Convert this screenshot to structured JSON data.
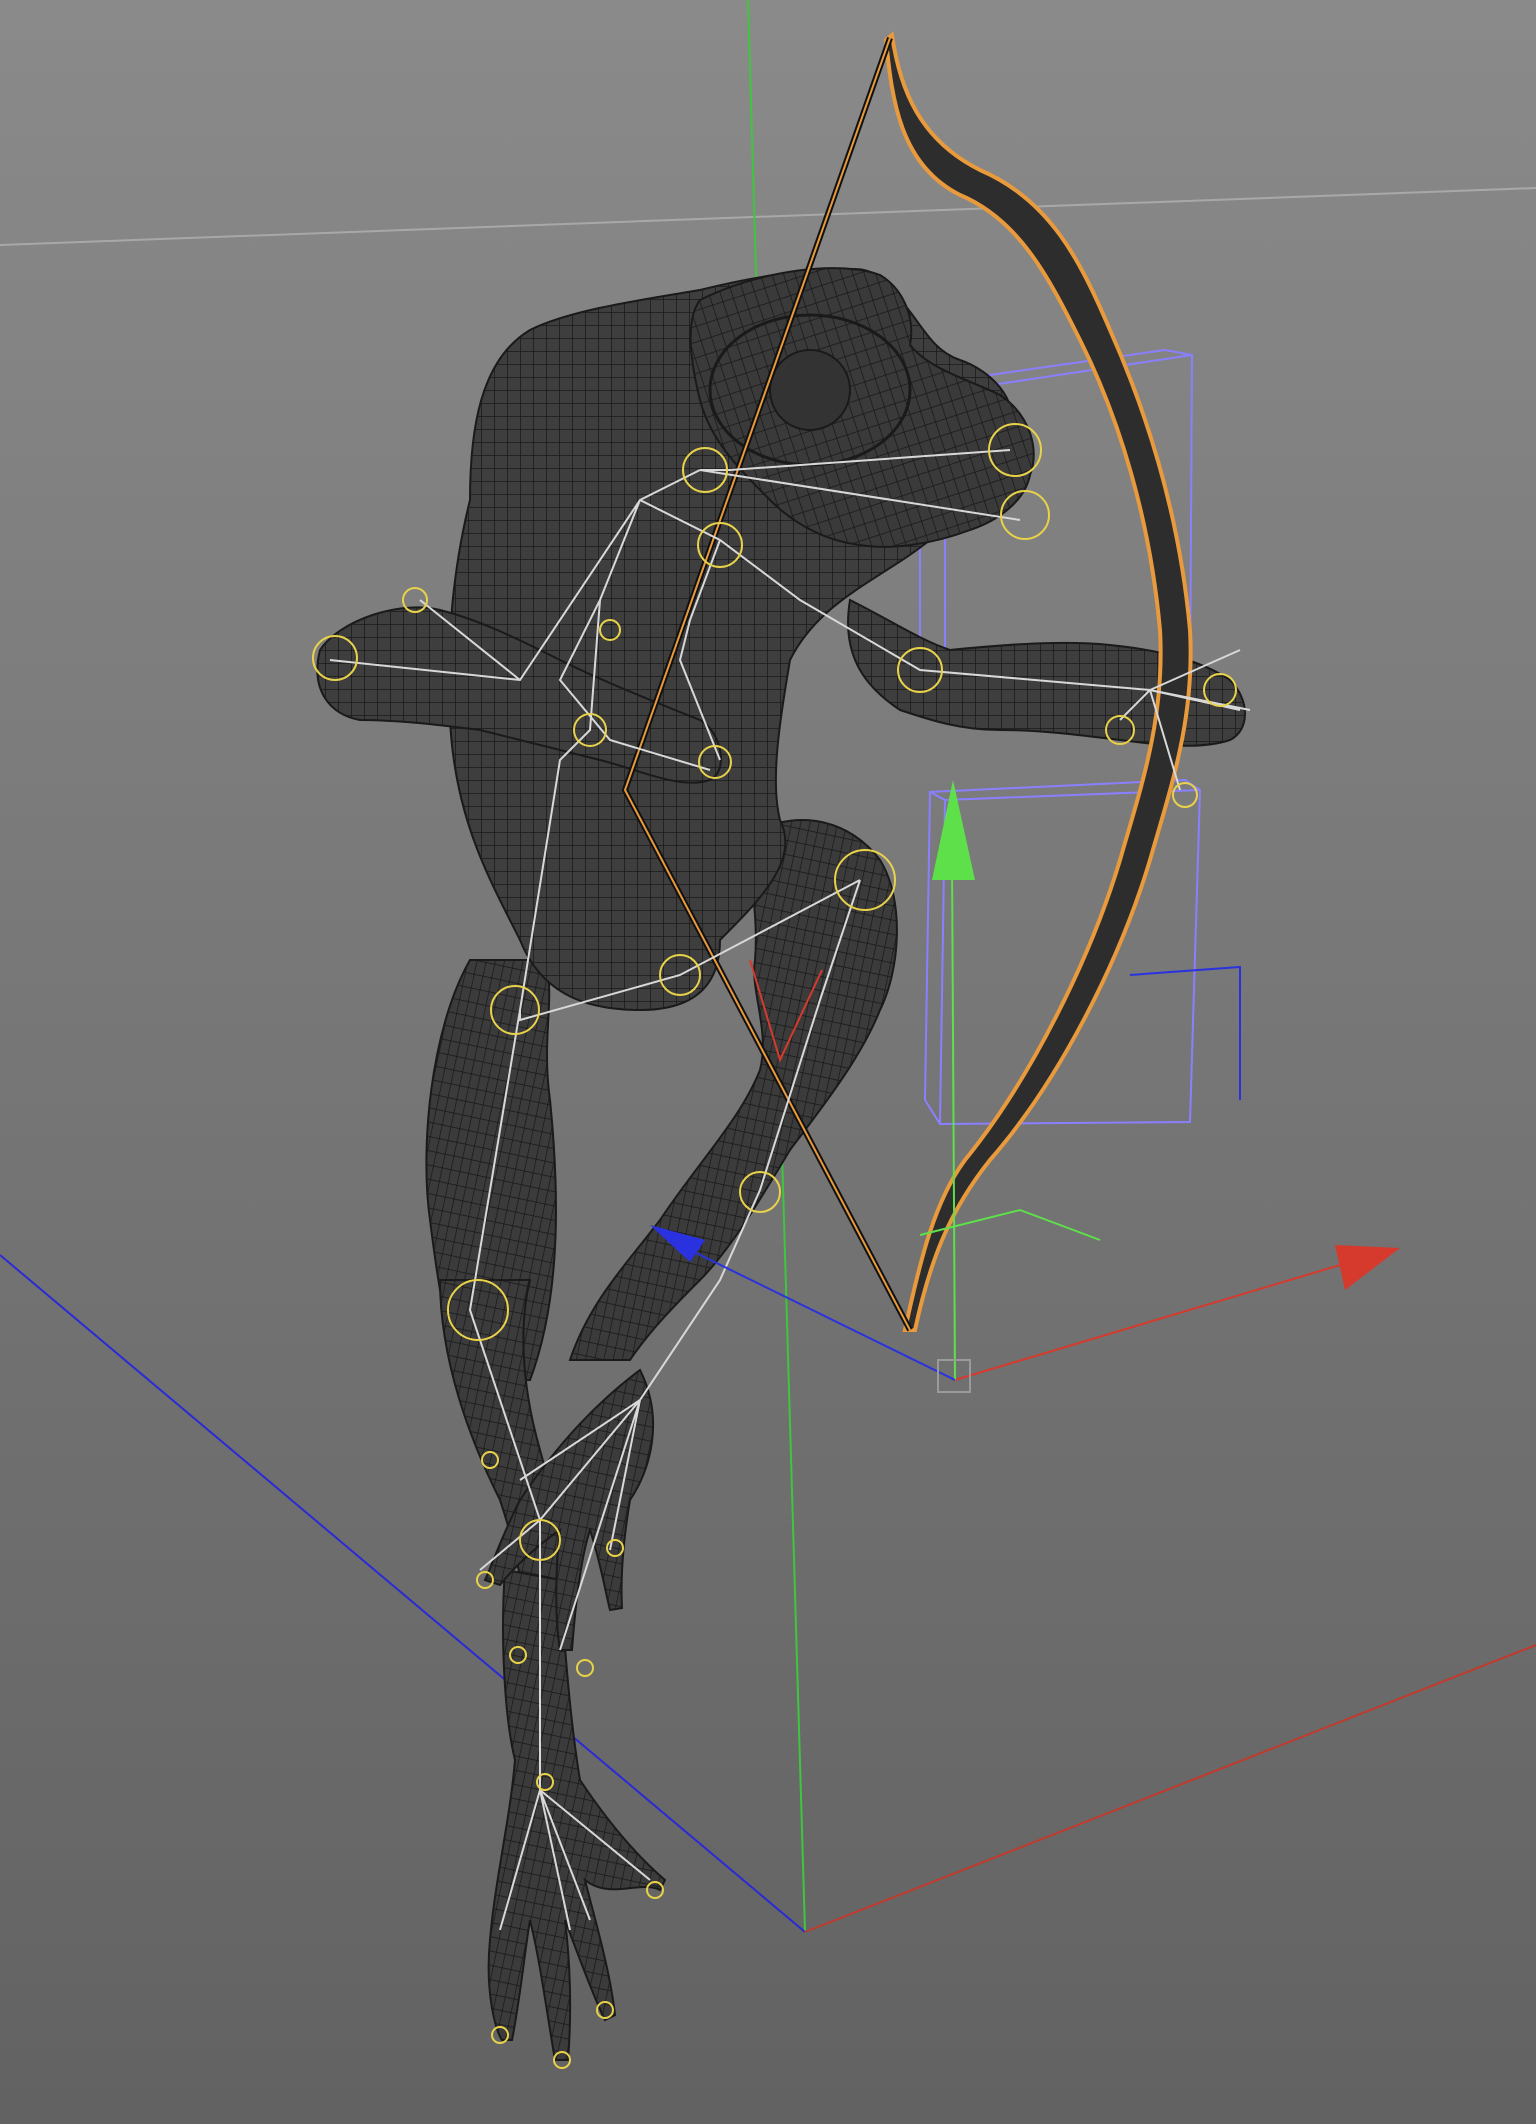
{
  "viewport": {
    "background_top": "#8a8a8a",
    "background_bottom": "#626262",
    "grid_line_color": "#a8a8a8"
  },
  "world_axes": {
    "x_color": "#c23a2c",
    "y_color": "#3ec63e",
    "z_color": "#2a2ad6"
  },
  "selection_color": "#e89a3c",
  "bounding_box_color": "#8a80ff",
  "joint_color": "#e8d24a",
  "bone_color": "#d8d8d8",
  "mesh_fill": "#3c3c3c",
  "mesh_wire": "#1b1b1b",
  "gizmo": {
    "x_color": "#d63a2c",
    "y_color": "#5ee04a",
    "z_color": "#2a32e0"
  },
  "objects": {
    "character": "frog-mesh",
    "prop": "bow-mesh",
    "rig": "joint-skeleton"
  }
}
